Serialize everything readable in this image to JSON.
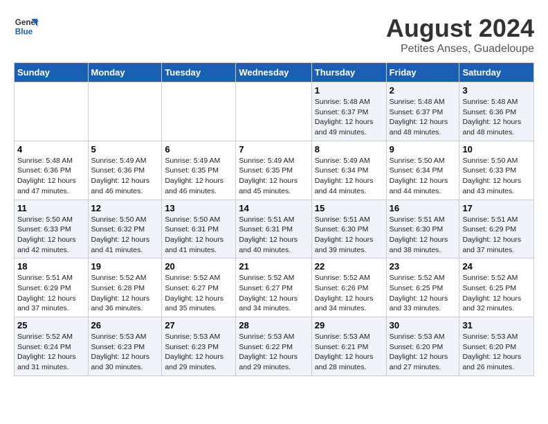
{
  "logo": {
    "line1": "General",
    "line2": "Blue"
  },
  "title": "August 2024",
  "subtitle": "Petites Anses, Guadeloupe",
  "days_of_week": [
    "Sunday",
    "Monday",
    "Tuesday",
    "Wednesday",
    "Thursday",
    "Friday",
    "Saturday"
  ],
  "weeks": [
    [
      {
        "day": "",
        "info": ""
      },
      {
        "day": "",
        "info": ""
      },
      {
        "day": "",
        "info": ""
      },
      {
        "day": "",
        "info": ""
      },
      {
        "day": "1",
        "info": "Sunrise: 5:48 AM\nSunset: 6:37 PM\nDaylight: 12 hours\nand 49 minutes."
      },
      {
        "day": "2",
        "info": "Sunrise: 5:48 AM\nSunset: 6:37 PM\nDaylight: 12 hours\nand 48 minutes."
      },
      {
        "day": "3",
        "info": "Sunrise: 5:48 AM\nSunset: 6:36 PM\nDaylight: 12 hours\nand 48 minutes."
      }
    ],
    [
      {
        "day": "4",
        "info": "Sunrise: 5:48 AM\nSunset: 6:36 PM\nDaylight: 12 hours\nand 47 minutes."
      },
      {
        "day": "5",
        "info": "Sunrise: 5:49 AM\nSunset: 6:36 PM\nDaylight: 12 hours\nand 46 minutes."
      },
      {
        "day": "6",
        "info": "Sunrise: 5:49 AM\nSunset: 6:35 PM\nDaylight: 12 hours\nand 46 minutes."
      },
      {
        "day": "7",
        "info": "Sunrise: 5:49 AM\nSunset: 6:35 PM\nDaylight: 12 hours\nand 45 minutes."
      },
      {
        "day": "8",
        "info": "Sunrise: 5:49 AM\nSunset: 6:34 PM\nDaylight: 12 hours\nand 44 minutes."
      },
      {
        "day": "9",
        "info": "Sunrise: 5:50 AM\nSunset: 6:34 PM\nDaylight: 12 hours\nand 44 minutes."
      },
      {
        "day": "10",
        "info": "Sunrise: 5:50 AM\nSunset: 6:33 PM\nDaylight: 12 hours\nand 43 minutes."
      }
    ],
    [
      {
        "day": "11",
        "info": "Sunrise: 5:50 AM\nSunset: 6:33 PM\nDaylight: 12 hours\nand 42 minutes."
      },
      {
        "day": "12",
        "info": "Sunrise: 5:50 AM\nSunset: 6:32 PM\nDaylight: 12 hours\nand 41 minutes."
      },
      {
        "day": "13",
        "info": "Sunrise: 5:50 AM\nSunset: 6:31 PM\nDaylight: 12 hours\nand 41 minutes."
      },
      {
        "day": "14",
        "info": "Sunrise: 5:51 AM\nSunset: 6:31 PM\nDaylight: 12 hours\nand 40 minutes."
      },
      {
        "day": "15",
        "info": "Sunrise: 5:51 AM\nSunset: 6:30 PM\nDaylight: 12 hours\nand 39 minutes."
      },
      {
        "day": "16",
        "info": "Sunrise: 5:51 AM\nSunset: 6:30 PM\nDaylight: 12 hours\nand 38 minutes."
      },
      {
        "day": "17",
        "info": "Sunrise: 5:51 AM\nSunset: 6:29 PM\nDaylight: 12 hours\nand 37 minutes."
      }
    ],
    [
      {
        "day": "18",
        "info": "Sunrise: 5:51 AM\nSunset: 6:29 PM\nDaylight: 12 hours\nand 37 minutes."
      },
      {
        "day": "19",
        "info": "Sunrise: 5:52 AM\nSunset: 6:28 PM\nDaylight: 12 hours\nand 36 minutes."
      },
      {
        "day": "20",
        "info": "Sunrise: 5:52 AM\nSunset: 6:27 PM\nDaylight: 12 hours\nand 35 minutes."
      },
      {
        "day": "21",
        "info": "Sunrise: 5:52 AM\nSunset: 6:27 PM\nDaylight: 12 hours\nand 34 minutes."
      },
      {
        "day": "22",
        "info": "Sunrise: 5:52 AM\nSunset: 6:26 PM\nDaylight: 12 hours\nand 34 minutes."
      },
      {
        "day": "23",
        "info": "Sunrise: 5:52 AM\nSunset: 6:25 PM\nDaylight: 12 hours\nand 33 minutes."
      },
      {
        "day": "24",
        "info": "Sunrise: 5:52 AM\nSunset: 6:25 PM\nDaylight: 12 hours\nand 32 minutes."
      }
    ],
    [
      {
        "day": "25",
        "info": "Sunrise: 5:52 AM\nSunset: 6:24 PM\nDaylight: 12 hours\nand 31 minutes."
      },
      {
        "day": "26",
        "info": "Sunrise: 5:53 AM\nSunset: 6:23 PM\nDaylight: 12 hours\nand 30 minutes."
      },
      {
        "day": "27",
        "info": "Sunrise: 5:53 AM\nSunset: 6:23 PM\nDaylight: 12 hours\nand 29 minutes."
      },
      {
        "day": "28",
        "info": "Sunrise: 5:53 AM\nSunset: 6:22 PM\nDaylight: 12 hours\nand 29 minutes."
      },
      {
        "day": "29",
        "info": "Sunrise: 5:53 AM\nSunset: 6:21 PM\nDaylight: 12 hours\nand 28 minutes."
      },
      {
        "day": "30",
        "info": "Sunrise: 5:53 AM\nSunset: 6:20 PM\nDaylight: 12 hours\nand 27 minutes."
      },
      {
        "day": "31",
        "info": "Sunrise: 5:53 AM\nSunset: 6:20 PM\nDaylight: 12 hours\nand 26 minutes."
      }
    ]
  ]
}
